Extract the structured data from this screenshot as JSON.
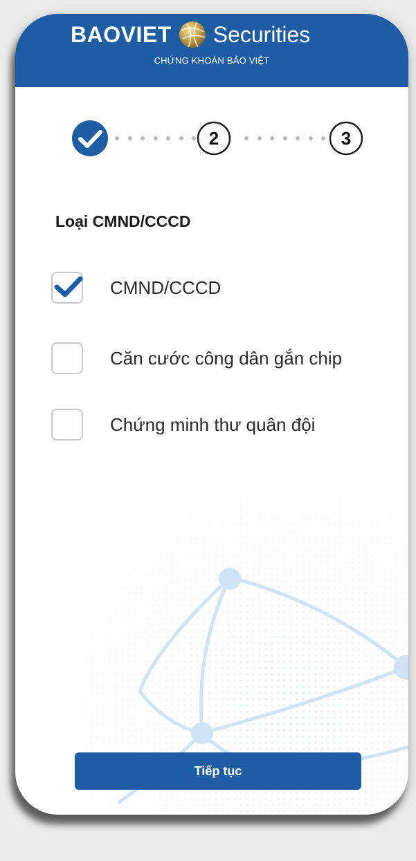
{
  "header": {
    "brand_left": "BAOVIET",
    "brand_right": "Securities",
    "subtitle": "CHỨNG KHOÁN BẢO VIỆT"
  },
  "stepper": {
    "steps": [
      {
        "label": "",
        "state": "done"
      },
      {
        "label": "2",
        "state": "pending"
      },
      {
        "label": "3",
        "state": "pending"
      }
    ]
  },
  "form": {
    "title": "Loại CMND/CCCD",
    "options": [
      {
        "label": "CMND/CCCD",
        "checked": true
      },
      {
        "label": "Căn cước công dân gắn chip",
        "checked": false
      },
      {
        "label": "Chứng minh thư quân đội",
        "checked": false
      }
    ]
  },
  "actions": {
    "continue_label": "Tiếp tục"
  },
  "colors": {
    "primary": "#1e5da3",
    "check_blue": "#1e5da3",
    "checkbox_border": "#c9c9c9",
    "background_art": "#cfe3f5"
  },
  "icons": [
    "globe-logo-icon",
    "checkmark-icon",
    "checkbox-check-icon"
  ]
}
